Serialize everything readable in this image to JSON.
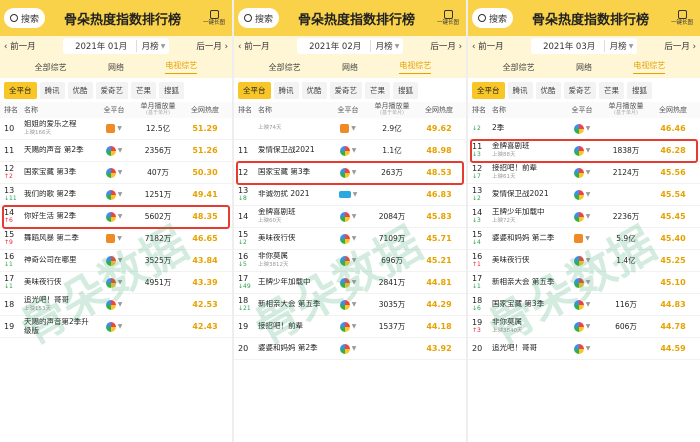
{
  "panels": [
    {
      "search": "搜索",
      "title": "骨朵热度指数排行榜",
      "share": "一键长图",
      "prev": "前一月",
      "next": "后一月",
      "date": "2021年 01月",
      "mode": "月榜",
      "cats": [
        "全部综艺",
        "网络",
        "电视综艺"
      ],
      "platforms": [
        "全平台",
        "腾讯",
        "优酷",
        "爱奇艺",
        "芒果",
        "搜狐"
      ],
      "headers": {
        "rank": "排名",
        "name": "名称",
        "plat": "全平台",
        "views": "单月播放量",
        "views_sub": "(基于单月)",
        "heat": "全网热度"
      },
      "rows": [
        {
          "rank": "10",
          "ch": "",
          "name": "姐姐的爱乐之程",
          "sub": "上映166天",
          "icon": "m",
          "views": "12.5亿",
          "heat": "51.29"
        },
        {
          "rank": "11",
          "ch": "",
          "name": "天赐的声音 第2季",
          "sub": "",
          "icon": "c",
          "views": "2356万",
          "heat": "51.26"
        },
        {
          "rank": "12",
          "ch": "↑2",
          "name": "国家宝藏 第3季",
          "sub": "",
          "icon": "c",
          "views": "407万",
          "heat": "50.30"
        },
        {
          "rank": "13",
          "ch": "↓11",
          "name": "我们的歌 第2季",
          "sub": "",
          "icon": "c",
          "views": "1251万",
          "heat": "49.41"
        },
        {
          "rank": "14",
          "ch": "↑6",
          "name": "你好生活 第2季",
          "sub": "",
          "icon": "c",
          "views": "5602万",
          "heat": "48.35"
        },
        {
          "rank": "15",
          "ch": "↑9",
          "name": "舞蹈风暴 第二季",
          "sub": "",
          "icon": "m",
          "views": "7182万",
          "heat": "46.65"
        },
        {
          "rank": "16",
          "ch": "↓1",
          "name": "神奇公司在哪里",
          "sub": "",
          "icon": "c",
          "views": "3525万",
          "heat": "43.84"
        },
        {
          "rank": "17",
          "ch": "↓1",
          "name": "美味夜行侠",
          "sub": "",
          "icon": "c",
          "views": "4951万",
          "heat": "43.39"
        },
        {
          "rank": "18",
          "ch": "",
          "name": "追光吧！哥哥",
          "sub": "上映153天",
          "icon": "c",
          "views": "",
          "heat": "42.53"
        },
        {
          "rank": "19",
          "ch": "",
          "name": "天赐的声音第2季升级版",
          "sub": "",
          "icon": "c",
          "views": "",
          "heat": "42.43"
        }
      ],
      "hl": 4
    },
    {
      "search": "搜索",
      "title": "骨朵热度指数排行榜",
      "share": "一键长图",
      "prev": "前一月",
      "next": "后一月",
      "date": "2021年 02月",
      "mode": "月榜",
      "cats": [
        "全部综艺",
        "网络",
        "电视综艺"
      ],
      "platforms": [
        "全平台",
        "腾讯",
        "优酷",
        "爱奇艺",
        "芒果",
        "搜狐"
      ],
      "headers": {
        "rank": "排名",
        "name": "名称",
        "plat": "全平台",
        "views": "单月播放量",
        "views_sub": "(基于单月)",
        "heat": "全网热度"
      },
      "rows": [
        {
          "rank": "",
          "ch": "",
          "name": "",
          "sub": "上映74天",
          "icon": "m",
          "views": "2.9亿",
          "heat": "49.62"
        },
        {
          "rank": "11",
          "ch": "",
          "name": "爱情保卫战2021",
          "sub": "",
          "icon": "c",
          "views": "1.1亿",
          "heat": "48.98"
        },
        {
          "rank": "12",
          "ch": "",
          "name": "国家宝藏 第3季",
          "sub": "",
          "icon": "c",
          "views": "263万",
          "heat": "48.53"
        },
        {
          "rank": "13",
          "ch": "↓8",
          "name": "非诚勿扰 2021",
          "sub": "",
          "icon": "y",
          "views": "",
          "heat": "46.83"
        },
        {
          "rank": "14",
          "ch": "",
          "name": "金牌喜剧班",
          "sub": "上映60天",
          "icon": "c",
          "views": "2084万",
          "heat": "45.83"
        },
        {
          "rank": "15",
          "ch": "↓2",
          "name": "美味夜行侠",
          "sub": "",
          "icon": "c",
          "views": "7109万",
          "heat": "45.71"
        },
        {
          "rank": "16",
          "ch": "↓5",
          "name": "非你莫属",
          "sub": "上映3812天",
          "icon": "c",
          "views": "696万",
          "heat": "45.21"
        },
        {
          "rank": "17",
          "ch": "↓49",
          "name": "王牌少年加载中",
          "sub": "",
          "icon": "c",
          "views": "2841万",
          "heat": "44.81"
        },
        {
          "rank": "18",
          "ch": "↓21",
          "name": "新相亲大会 第五季",
          "sub": "",
          "icon": "c",
          "views": "3035万",
          "heat": "44.29"
        },
        {
          "rank": "19",
          "ch": "",
          "name": "接招吧！前辈",
          "sub": "",
          "icon": "c",
          "views": "1537万",
          "heat": "44.18"
        },
        {
          "rank": "20",
          "ch": "",
          "name": "婆婆和妈妈 第2季",
          "sub": "",
          "icon": "c",
          "views": "",
          "heat": "43.92"
        }
      ],
      "hl": 2
    },
    {
      "search": "搜索",
      "title": "骨朵热度指数排行榜",
      "share": "一键长图",
      "prev": "前一月",
      "next": "后一月",
      "date": "2021年 03月",
      "mode": "月榜",
      "cats": [
        "全部综艺",
        "网络",
        "电视综艺"
      ],
      "platforms": [
        "全平台",
        "腾讯",
        "优酷",
        "爱奇艺",
        "芒果",
        "搜狐"
      ],
      "headers": {
        "rank": "排名",
        "name": "名称",
        "plat": "全平台",
        "views": "单月播放量",
        "views_sub": "(基于单月)",
        "heat": "全网热度"
      },
      "rows": [
        {
          "rank": "",
          "ch": "↓2",
          "name": "2季",
          "sub": "",
          "icon": "c",
          "views": "",
          "heat": "46.46"
        },
        {
          "rank": "11",
          "ch": "↓3",
          "name": "金牌喜剧班",
          "sub": "上映88天",
          "icon": "c",
          "views": "1838万",
          "heat": "46.28"
        },
        {
          "rank": "12",
          "ch": "↓7",
          "name": "接招吧！前辈",
          "sub": "上映61天",
          "icon": "c",
          "views": "2124万",
          "heat": "45.56"
        },
        {
          "rank": "13",
          "ch": "↓2",
          "name": "爱情保卫战2021",
          "sub": "",
          "icon": "c",
          "views": "",
          "heat": "45.54"
        },
        {
          "rank": "14",
          "ch": "↓3",
          "name": "王牌少年加载中",
          "sub": "上映72天",
          "icon": "c",
          "views": "2236万",
          "heat": "45.45"
        },
        {
          "rank": "15",
          "ch": "↓4",
          "name": "婆婆和妈妈 第二季",
          "sub": "",
          "icon": "m",
          "views": "5.9亿",
          "heat": "45.40"
        },
        {
          "rank": "16",
          "ch": "↑1",
          "name": "美味夜行侠",
          "sub": "",
          "icon": "c",
          "views": "1.4亿",
          "heat": "45.25"
        },
        {
          "rank": "17",
          "ch": "↓1",
          "name": "新相亲大会 第五季",
          "sub": "",
          "icon": "c",
          "views": "",
          "heat": "45.10"
        },
        {
          "rank": "18",
          "ch": "↓6",
          "name": "国家宝藏 第3季",
          "sub": "",
          "icon": "c",
          "views": "116万",
          "heat": "44.83"
        },
        {
          "rank": "19",
          "ch": "↑3",
          "name": "非你莫属",
          "sub": "上映3840天",
          "icon": "c",
          "views": "606万",
          "heat": "44.78"
        },
        {
          "rank": "20",
          "ch": "",
          "name": "追光吧！哥哥",
          "sub": "",
          "icon": "c",
          "views": "",
          "heat": "44.59"
        }
      ],
      "hl": 1
    }
  ],
  "watermark": "骨朵数据"
}
